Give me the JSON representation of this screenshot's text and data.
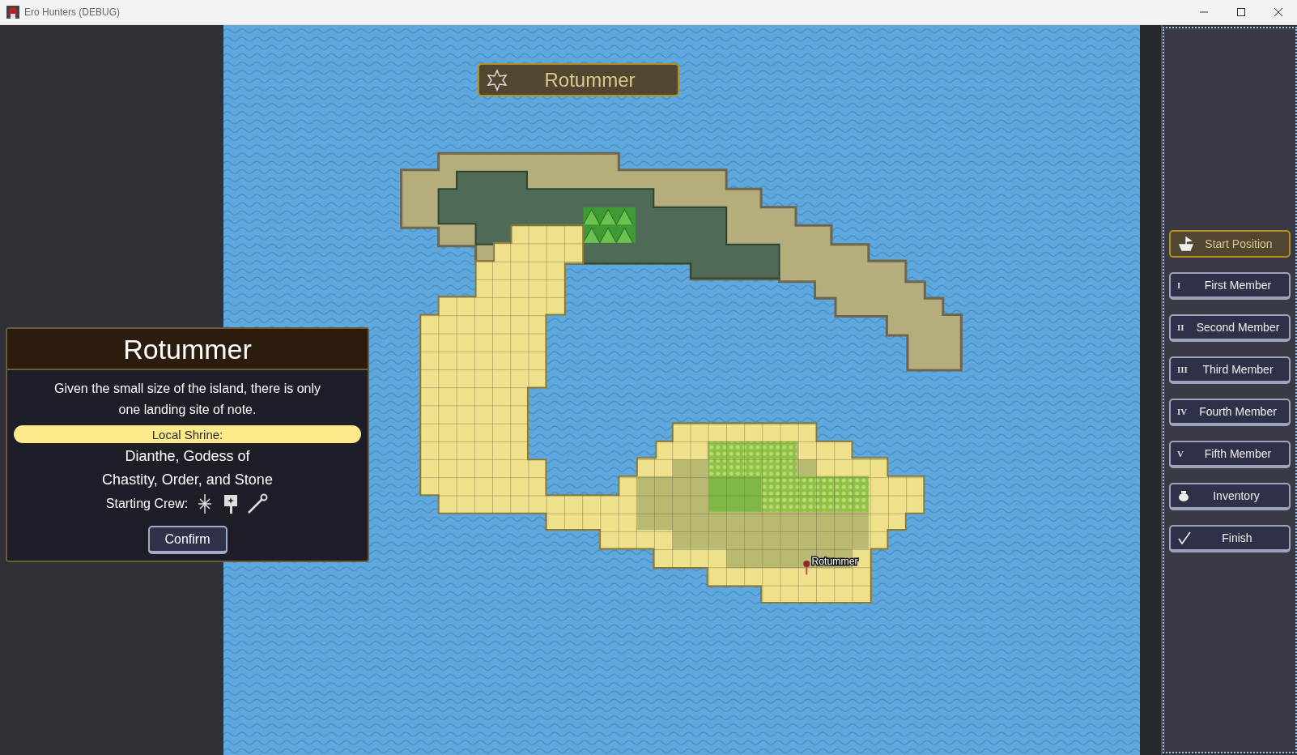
{
  "window": {
    "title": "Ero Hunters (DEBUG)"
  },
  "map": {
    "region_banner": "Rotummer",
    "place_label": "Rotummer"
  },
  "info_panel": {
    "title": "Rotummer",
    "description": "Given the small size of the island, there is only one landing site of note.",
    "shrine_label": "Local Shrine:",
    "deity": "Dianthe, Godess of\nChastity, Order, and Stone",
    "crew_label": "Starting Crew:",
    "confirm": "Confirm"
  },
  "sidebar": {
    "buttons": [
      {
        "kind": "ship",
        "label": "Start Position",
        "selected": true
      },
      {
        "kind": "numeral",
        "numeral": "I",
        "label": "First Member",
        "selected": false
      },
      {
        "kind": "numeral",
        "numeral": "II",
        "label": "Second Member",
        "selected": false
      },
      {
        "kind": "numeral",
        "numeral": "III",
        "label": "Third Member",
        "selected": false
      },
      {
        "kind": "numeral",
        "numeral": "IV",
        "label": "Fourth Member",
        "selected": false
      },
      {
        "kind": "numeral",
        "numeral": "V",
        "label": "Fifth Member",
        "selected": false
      },
      {
        "kind": "bag",
        "label": "Inventory",
        "selected": false
      },
      {
        "kind": "check",
        "label": "Finish",
        "selected": false
      }
    ]
  }
}
